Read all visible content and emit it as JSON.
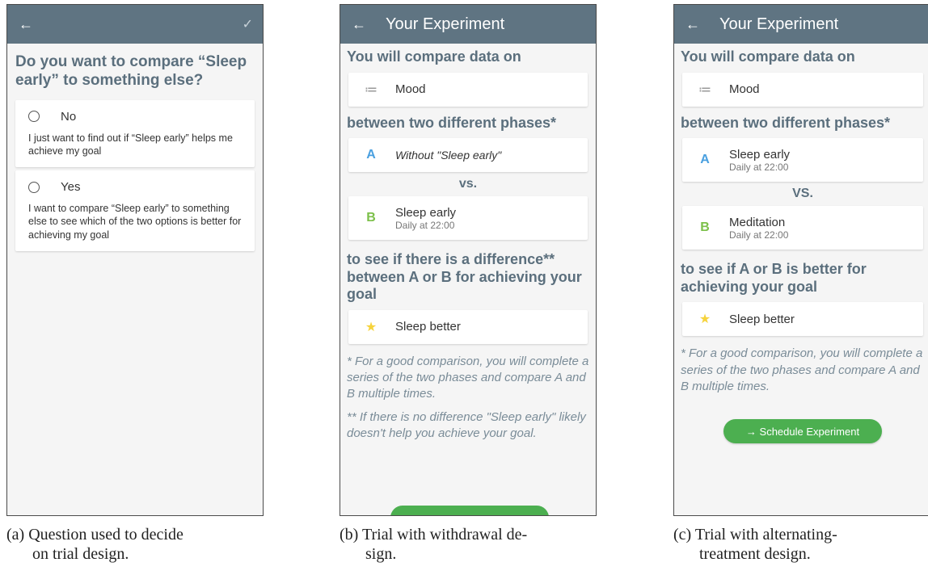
{
  "screen_a": {
    "question": "Do you want to compare “Sleep early” to something else?",
    "options": [
      {
        "label": "No",
        "description": "I just want to find out if “Sleep early” helps me achieve my goal"
      },
      {
        "label": "Yes",
        "description": "I want to compare “Sleep early” to something else to see which of the two options is better for achieving my goal"
      }
    ]
  },
  "screen_b": {
    "title": "Your Experiment",
    "compare_heading": "You will compare data on",
    "measure": "Mood",
    "phases_heading": "between two different phases*",
    "phase_a": {
      "letter": "A",
      "name": "Without \"Sleep early\""
    },
    "vs": "vs.",
    "phase_b": {
      "letter": "B",
      "name": "Sleep early",
      "schedule": "Daily at 22:00"
    },
    "goal_heading": "to see if there is a difference** between A or B for achieving your goal",
    "goal": "Sleep better",
    "note1": "* For a good comparison, you will complete a series of the two phases and compare A and B multiple times.",
    "note2": "** If there is no difference \"Sleep early\" likely doesn't help you achieve your goal."
  },
  "screen_c": {
    "title": "Your Experiment",
    "compare_heading": "You will compare data on",
    "measure": "Mood",
    "phases_heading": "between two different phases*",
    "phase_a": {
      "letter": "A",
      "name": "Sleep early",
      "schedule": "Daily at 22:00"
    },
    "vs": "VS.",
    "phase_b": {
      "letter": "B",
      "name": "Meditation",
      "schedule": "Daily at 22:00"
    },
    "goal_heading": "to see if A or B is better for achieving your goal",
    "goal": "Sleep better",
    "note1": "* For a good comparison, you will complete a series of the two phases and compare A and B multiple times.",
    "cta": "→ Schedule Experiment"
  },
  "captions": {
    "a_line1": "(a) Question used to decide",
    "a_line2": "on trial design.",
    "b_line1": "(b) Trial with withdrawal de-",
    "b_line2": "sign.",
    "c_line1": "(c) Trial with alternating-",
    "c_line2": "treatment design."
  },
  "colors": {
    "appbar": "#5f7482",
    "heading": "#5b6f7d",
    "phase_a": "#4aa0e0",
    "phase_b": "#7cc04a",
    "star": "#f6d33c",
    "cta": "#4caf50"
  }
}
